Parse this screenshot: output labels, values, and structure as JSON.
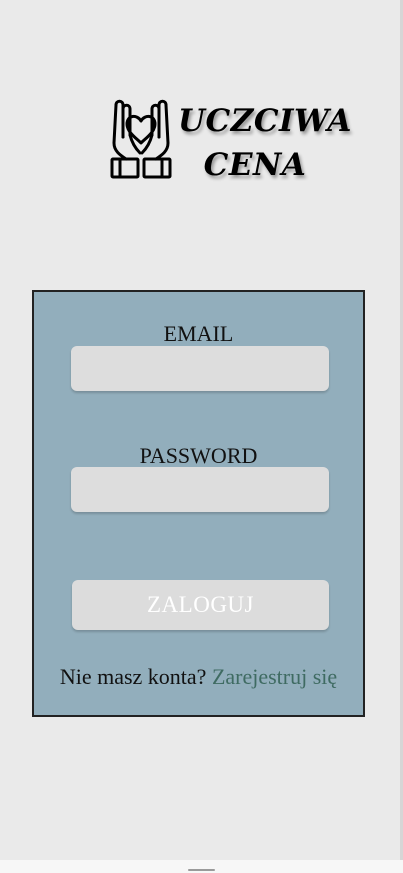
{
  "logo": {
    "line1": "UCZCIWA",
    "line2": "CENA",
    "icon": "hands-heart-icon"
  },
  "login": {
    "email_label": "EMAIL",
    "email_value": "",
    "password_label": "PASSWORD",
    "password_value": "",
    "submit_label": "ZALOGUJ",
    "no_account_text": "Nie masz konta?",
    "register_link": "Zarejestruj się"
  },
  "colors": {
    "background": "#eaeaea",
    "card": "#92aebc",
    "input": "#dddddd",
    "link": "#3f6b62"
  }
}
